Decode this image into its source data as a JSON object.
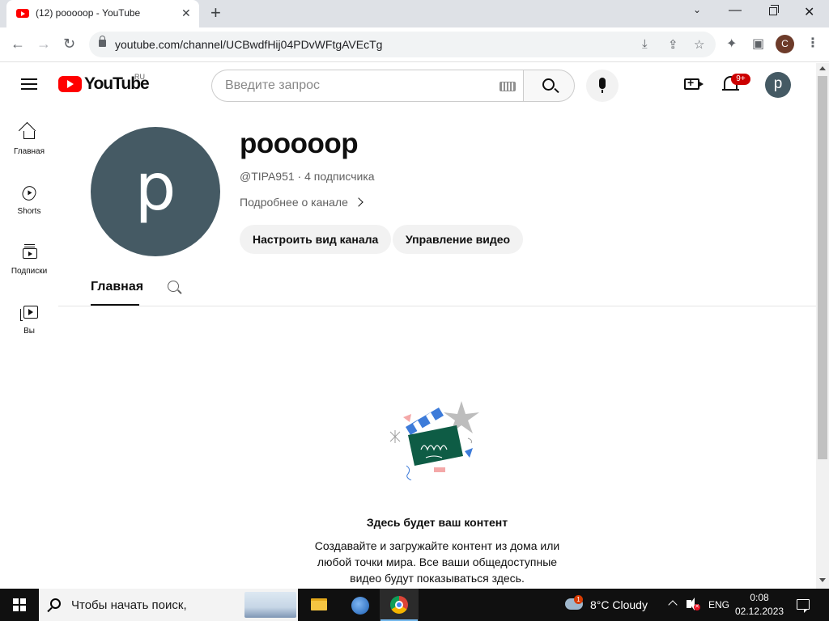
{
  "browser": {
    "tab_title": "(12) poooooр - YouTube",
    "tab_close": "✕",
    "new_tab": "+",
    "url": "youtube.com/channel/UCBwdfHij04PDvWFtgAVEcTg",
    "profile_initial": "C"
  },
  "masthead": {
    "logo_text": "YouTube",
    "region": "RU",
    "search_placeholder": "Введите запрос",
    "notifications_count": "9+",
    "avatar_initial": "p"
  },
  "guide": {
    "items": [
      {
        "label": "Главная",
        "icon": "home-icon"
      },
      {
        "label": "Shorts",
        "icon": "shorts-icon"
      },
      {
        "label": "Подписки",
        "icon": "subscriptions-icon"
      },
      {
        "label": "Вы",
        "icon": "you-icon"
      }
    ]
  },
  "channel": {
    "avatar_initial": "p",
    "name": "poooooр",
    "meta": "@TIPA951 · 4 подписчика",
    "more_link": "Подробнее о канале",
    "buttons": {
      "customize": "Настроить вид канала",
      "manage_videos": "Управление видео"
    },
    "tabs": [
      {
        "label": "Главная",
        "active": true
      }
    ]
  },
  "empty_state": {
    "title": "Здесь будет ваш контент",
    "description": "Создавайте и загружайте контент из дома или любой точки мира. Все ваши общедоступные видео будут показываться здесь."
  },
  "taskbar": {
    "search_placeholder": "Чтобы начать поиск,",
    "weather_badge": "1",
    "weather": "8°C  Cloudy",
    "language": "ENG",
    "time": "0:08",
    "date": "02.12.2023"
  },
  "colors": {
    "youtube_red": "#ff0000",
    "avatar_bg": "#455a64",
    "notification_badge": "#cc0000",
    "taskbar_bg": "#101010"
  }
}
